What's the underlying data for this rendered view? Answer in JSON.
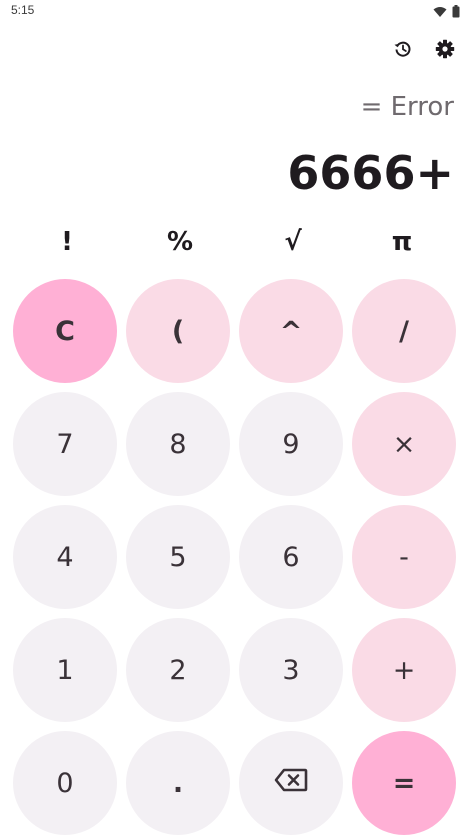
{
  "status_bar": {
    "time": "5:15",
    "icons": [
      "wifi-icon",
      "battery-icon"
    ]
  },
  "toolbar": {
    "icons": [
      "history-icon",
      "settings-icon"
    ]
  },
  "display": {
    "result": "= Error",
    "expression": "6666+"
  },
  "scientific": [
    "!",
    "%",
    "√",
    "π"
  ],
  "keys": {
    "clear": "C",
    "paren": "(",
    "power": "^",
    "divide": "/",
    "seven": "7",
    "eight": "8",
    "nine": "9",
    "multiply": "×",
    "four": "4",
    "five": "5",
    "six": "6",
    "minus": "-",
    "one": "1",
    "two": "2",
    "three": "3",
    "plus": "+",
    "zero": "0",
    "dot": ".",
    "backspace_icon": "backspace-icon",
    "equals": "="
  },
  "colors": {
    "number_key": "#f3f0f4",
    "operator_key": "#fadbe6",
    "accent_key": "#ffb0d5",
    "text": "#1f1b1f"
  }
}
